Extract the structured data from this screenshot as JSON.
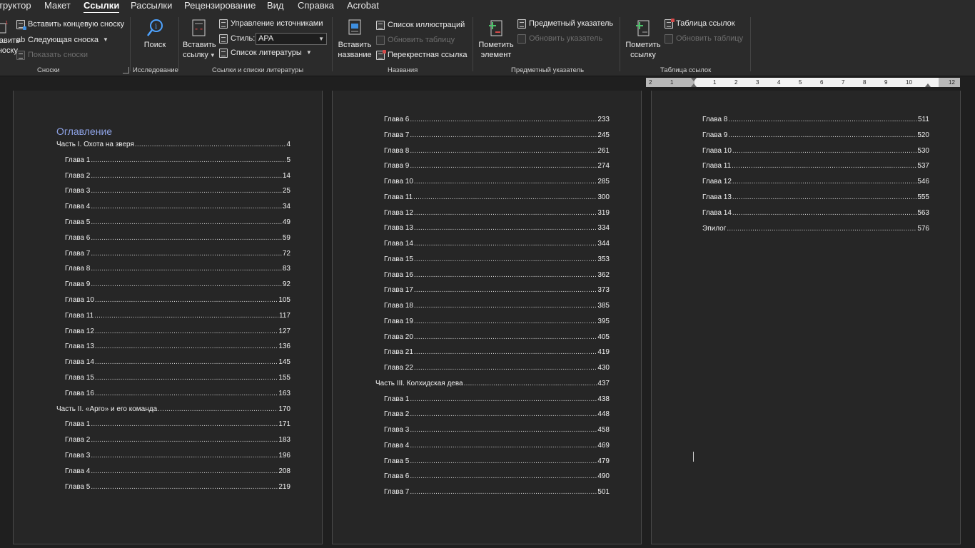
{
  "tabs": [
    {
      "label": "труктор",
      "active": false
    },
    {
      "label": "Макет",
      "active": false
    },
    {
      "label": "Ссылки",
      "active": true
    },
    {
      "label": "Рассылки",
      "active": false
    },
    {
      "label": "Рецензирование",
      "active": false
    },
    {
      "label": "Вид",
      "active": false
    },
    {
      "label": "Справка",
      "active": false
    },
    {
      "label": "Acrobat",
      "active": false
    }
  ],
  "ribbon": {
    "footnotes": {
      "cut_left": [
        "тавить",
        "носку"
      ],
      "insert_endnote": "Вставить концевую сноску",
      "next_footnote": "Следующая сноска",
      "show_notes": "Показать сноски",
      "group_label": "Сноски"
    },
    "research": {
      "search": "Поиск",
      "group_label": "Исследование"
    },
    "citations": {
      "insert_citation": [
        "Вставить",
        "ссылку"
      ],
      "manage_sources": "Управление источниками",
      "style_label": "Стиль:",
      "style_value": "APA",
      "bibliography": "Список литературы",
      "group_label": "Ссылки и списки литературы"
    },
    "captions": {
      "insert_caption": [
        "Вставить",
        "название"
      ],
      "table_of_figures": "Список иллюстраций",
      "update_table": "Обновить таблицу",
      "cross_reference": "Перекрестная ссылка",
      "group_label": "Названия"
    },
    "index": {
      "mark_entry": [
        "Пометить",
        "элемент"
      ],
      "insert_index": "Предметный указатель",
      "update_index": "Обновить указатель",
      "group_label": "Предметный указатель"
    },
    "toa": {
      "mark_citation": [
        "Пометить",
        "ссылку"
      ],
      "insert_toa": "Таблица ссылок",
      "update_table": "Обновить таблицу",
      "group_label": "Таблица ссылок"
    }
  },
  "ruler": {
    "labels": [
      "2",
      "1",
      "1",
      "2",
      "3",
      "4",
      "5",
      "6",
      "7",
      "8",
      "9",
      "10",
      "12"
    ]
  },
  "document": {
    "toc_heading": "Оглавление",
    "page1": [
      {
        "text": "Часть I. Охота на зверя",
        "page": "4",
        "level": 1
      },
      {
        "text": "Глава 1",
        "page": "5",
        "level": 2
      },
      {
        "text": "Глава 2",
        "page": "14",
        "level": 2
      },
      {
        "text": "Глава 3",
        "page": "25",
        "level": 2
      },
      {
        "text": "Глава 4",
        "page": "34",
        "level": 2
      },
      {
        "text": "Глава 5",
        "page": "49",
        "level": 2
      },
      {
        "text": "Глава 6",
        "page": "59",
        "level": 2
      },
      {
        "text": "Глава 7",
        "page": "72",
        "level": 2
      },
      {
        "text": "Глава 8",
        "page": "83",
        "level": 2
      },
      {
        "text": "Глава 9",
        "page": "92",
        "level": 2
      },
      {
        "text": "Глава 10",
        "page": "105",
        "level": 2
      },
      {
        "text": "Глава 11",
        "page": "117",
        "level": 2
      },
      {
        "text": "Глава 12",
        "page": "127",
        "level": 2
      },
      {
        "text": "Глава 13",
        "page": "136",
        "level": 2
      },
      {
        "text": "Глава 14",
        "page": "145",
        "level": 2
      },
      {
        "text": "Глава 15",
        "page": "155",
        "level": 2
      },
      {
        "text": "Глава 16",
        "page": "163",
        "level": 2
      },
      {
        "text": "Часть II. «Арго» и его команда",
        "page": "170",
        "level": 1
      },
      {
        "text": "Глава 1",
        "page": "171",
        "level": 2
      },
      {
        "text": "Глава 2",
        "page": "183",
        "level": 2
      },
      {
        "text": "Глава 3",
        "page": "196",
        "level": 2
      },
      {
        "text": "Глава 4",
        "page": "208",
        "level": 2
      },
      {
        "text": "Глава 5",
        "page": "219",
        "level": 2
      }
    ],
    "page2": [
      {
        "text": "Глава 6",
        "page": "233",
        "level": 2
      },
      {
        "text": "Глава 7",
        "page": "245",
        "level": 2
      },
      {
        "text": "Глава 8",
        "page": "261",
        "level": 2
      },
      {
        "text": "Глава 9",
        "page": "274",
        "level": 2
      },
      {
        "text": "Глава 10",
        "page": "285",
        "level": 2
      },
      {
        "text": "Глава 11",
        "page": "300",
        "level": 2
      },
      {
        "text": "Глава 12",
        "page": "319",
        "level": 2
      },
      {
        "text": "Глава 13",
        "page": "334",
        "level": 2
      },
      {
        "text": "Глава 14",
        "page": "344",
        "level": 2
      },
      {
        "text": "Глава 15",
        "page": "353",
        "level": 2
      },
      {
        "text": "Глава 16",
        "page": "362",
        "level": 2
      },
      {
        "text": "Глава 17",
        "page": "373",
        "level": 2
      },
      {
        "text": "Глава 18",
        "page": "385",
        "level": 2
      },
      {
        "text": "Глава 19",
        "page": "395",
        "level": 2
      },
      {
        "text": "Глава 20",
        "page": "405",
        "level": 2
      },
      {
        "text": "Глава 21",
        "page": "419",
        "level": 2
      },
      {
        "text": "Глава 22",
        "page": "430",
        "level": 2
      },
      {
        "text": "Часть III. Колхидская дева",
        "page": "437",
        "level": 1
      },
      {
        "text": "Глава 1",
        "page": "438",
        "level": 2
      },
      {
        "text": "Глава 2",
        "page": "448",
        "level": 2
      },
      {
        "text": "Глава 3",
        "page": "458",
        "level": 2
      },
      {
        "text": "Глава 4",
        "page": "469",
        "level": 2
      },
      {
        "text": "Глава 5",
        "page": "479",
        "level": 2
      },
      {
        "text": "Глава 6",
        "page": "490",
        "level": 2
      },
      {
        "text": "Глава 7",
        "page": "501",
        "level": 2
      }
    ],
    "page3": [
      {
        "text": "Глава 8",
        "page": "511",
        "level": 2
      },
      {
        "text": "Глава 9",
        "page": "520",
        "level": 2
      },
      {
        "text": "Глава 10",
        "page": "530",
        "level": 2
      },
      {
        "text": "Глава 11",
        "page": "537",
        "level": 2
      },
      {
        "text": "Глава 12",
        "page": "546",
        "level": 2
      },
      {
        "text": "Глава 13",
        "page": "555",
        "level": 2
      },
      {
        "text": "Глава 14",
        "page": "563",
        "level": 2
      },
      {
        "text": "Эпилог",
        "page": "576",
        "level": 1
      }
    ]
  },
  "colors": {
    "accent_heading": "#8ea3e6",
    "ribbon_bg": "#2b2b2b",
    "page_bg": "#262626"
  }
}
